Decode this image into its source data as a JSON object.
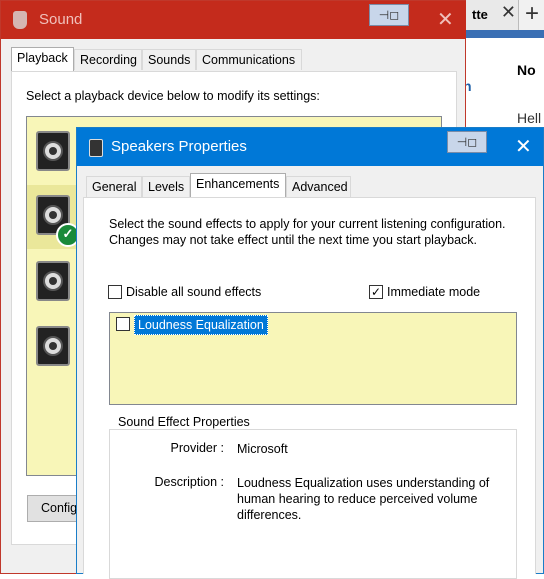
{
  "background_browser": {
    "tab_text": "tte",
    "close_glyph": "✕",
    "new_tab_glyph": "+",
    "text_no": "No",
    "text_n": "n",
    "text_hell": "Hell"
  },
  "sound_window": {
    "title": "Sound",
    "pin_glyph": "⊣◻",
    "close_glyph": "✕",
    "tabs": [
      "Playback",
      "Recording",
      "Sounds",
      "Communications"
    ],
    "instruction": "Select a playback device below to modify its settings:",
    "configure_label": "Configu"
  },
  "properties_dialog": {
    "title": "Speakers Properties",
    "pin_glyph": "⊣◻",
    "close_glyph": "✕",
    "tabs": [
      "General",
      "Levels",
      "Enhancements",
      "Advanced"
    ],
    "active_tab": "Enhancements",
    "description": "Select the sound effects to apply for your current listening configuration. Changes may not take effect until the next time you start playback.",
    "disable_all_label": "Disable all sound effects",
    "disable_all_checked": false,
    "immediate_mode_label": "Immediate mode",
    "immediate_mode_checked": true,
    "effects": [
      {
        "label": "Loudness Equalization",
        "checked": false,
        "selected": true
      }
    ],
    "sound_effect_properties": {
      "legend": "Sound Effect Properties",
      "provider_label": "Provider :",
      "provider_value": "Microsoft",
      "description_label": "Description :",
      "description_value": "Loudness Equalization uses understanding of human hearing to reduce perceived volume differences."
    }
  },
  "colors": {
    "sound_titlebar": "#c42b1c",
    "props_titlebar": "#0078d7",
    "list_background": "#f8f6b8",
    "default_check": "#1a8a3a"
  }
}
